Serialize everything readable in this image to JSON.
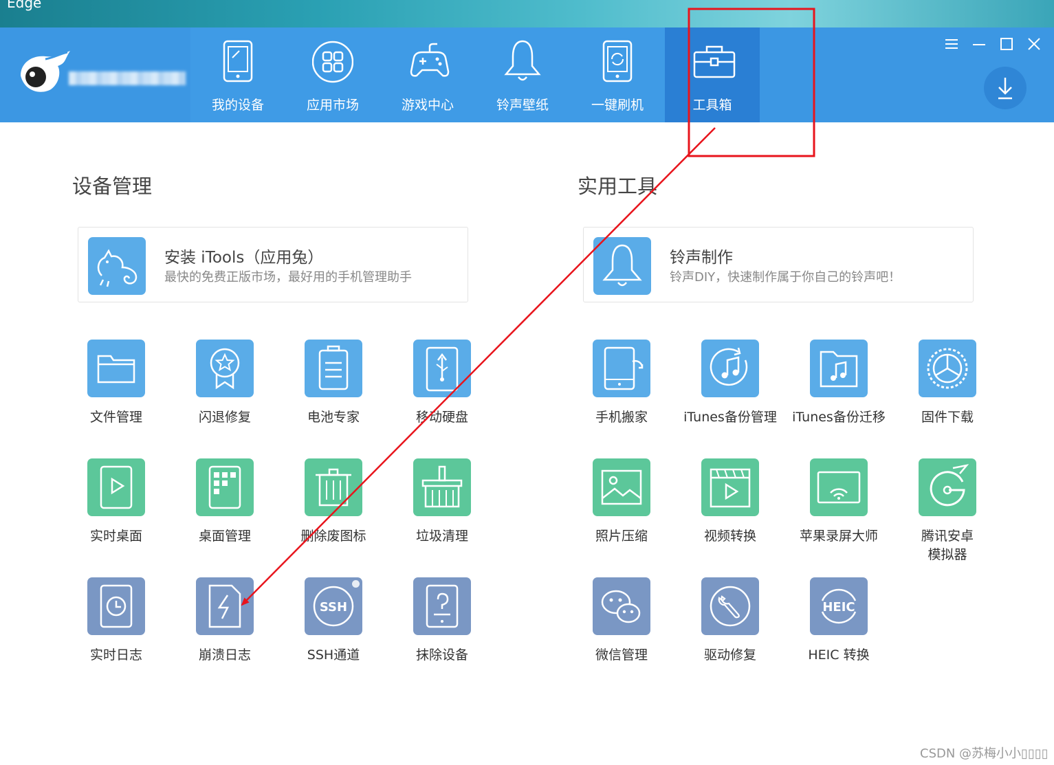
{
  "desktop": {
    "app_label": "Edge"
  },
  "nav": [
    {
      "label": "我的设备",
      "icon": "phone-icon"
    },
    {
      "label": "应用市场",
      "icon": "apps-grid-icon"
    },
    {
      "label": "游戏中心",
      "icon": "gamepad-icon"
    },
    {
      "label": "铃声壁纸",
      "icon": "bell-icon"
    },
    {
      "label": "一键刷机",
      "icon": "flash-phone-icon"
    },
    {
      "label": "工具箱",
      "icon": "toolbox-icon",
      "active": true
    }
  ],
  "left": {
    "title": "设备管理",
    "card": {
      "title": "安装 iTools（应用兔）",
      "desc": "最快的免费正版市场，最好用的手机管理助手",
      "icon": "rabbit-icon"
    },
    "tools": [
      {
        "label": "文件管理",
        "icon": "folder-icon",
        "color": "#5aace8"
      },
      {
        "label": "闪退修复",
        "icon": "star-badge-icon",
        "color": "#5aace8"
      },
      {
        "label": "电池专家",
        "icon": "battery-icon",
        "color": "#5aace8"
      },
      {
        "label": "移动硬盘",
        "icon": "usb-drive-icon",
        "color": "#5aace8"
      },
      {
        "label": "实时桌面",
        "icon": "play-screen-icon",
        "color": "#5cc79a"
      },
      {
        "label": "桌面管理",
        "icon": "desktop-grid-icon",
        "color": "#5cc79a"
      },
      {
        "label": "删除废图标",
        "icon": "trash-icon",
        "color": "#5cc79a"
      },
      {
        "label": "垃圾清理",
        "icon": "broom-icon",
        "color": "#5cc79a"
      },
      {
        "label": "实时日志",
        "icon": "clock-log-icon",
        "color": "#7a97c4"
      },
      {
        "label": "崩溃日志",
        "icon": "crash-log-icon",
        "color": "#7a97c4"
      },
      {
        "label": "SSH通道",
        "icon": "ssh-icon",
        "text": "SSH",
        "color": "#7a97c4"
      },
      {
        "label": "抹除设备",
        "icon": "erase-device-icon",
        "color": "#7a97c4"
      }
    ]
  },
  "right": {
    "title": "实用工具",
    "card": {
      "title": "铃声制作",
      "desc": "铃声DIY，快速制作属于你自己的铃声吧！",
      "icon": "bell-icon"
    },
    "tools": [
      {
        "label": "手机搬家",
        "icon": "phone-transfer-icon",
        "color": "#5aace8"
      },
      {
        "label": "iTunes备份管理",
        "icon": "music-circle-icon",
        "color": "#5aace8"
      },
      {
        "label": "iTunes备份迁移",
        "icon": "music-folder-icon",
        "color": "#5aace8"
      },
      {
        "label": "固件下载",
        "icon": "firmware-gear-icon",
        "color": "#5aace8"
      },
      {
        "label": "照片压缩",
        "icon": "photo-icon",
        "color": "#5cc79a"
      },
      {
        "label": "视频转换",
        "icon": "video-clapper-icon",
        "color": "#5cc79a"
      },
      {
        "label": "苹果录屏大师",
        "icon": "screen-cast-icon",
        "color": "#5cc79a"
      },
      {
        "label": "腾讯安卓\n模拟器",
        "label_line1": "腾讯安卓",
        "label_line2": "模拟器",
        "icon": "emulator-icon",
        "color": "#5cc79a"
      },
      {
        "label": "微信管理",
        "icon": "wechat-icon",
        "color": "#7a97c4"
      },
      {
        "label": "驱动修复",
        "icon": "wrench-icon",
        "color": "#7a97c4"
      },
      {
        "label": "HEIC 转换",
        "icon": "heic-icon",
        "text": "HEIC",
        "color": "#7a97c4"
      }
    ]
  },
  "annotation": {
    "highlight_color": "#e8141c",
    "arrow_color": "#e8141c"
  },
  "watermark": "CSDN @苏梅小小▯▯▯▯"
}
